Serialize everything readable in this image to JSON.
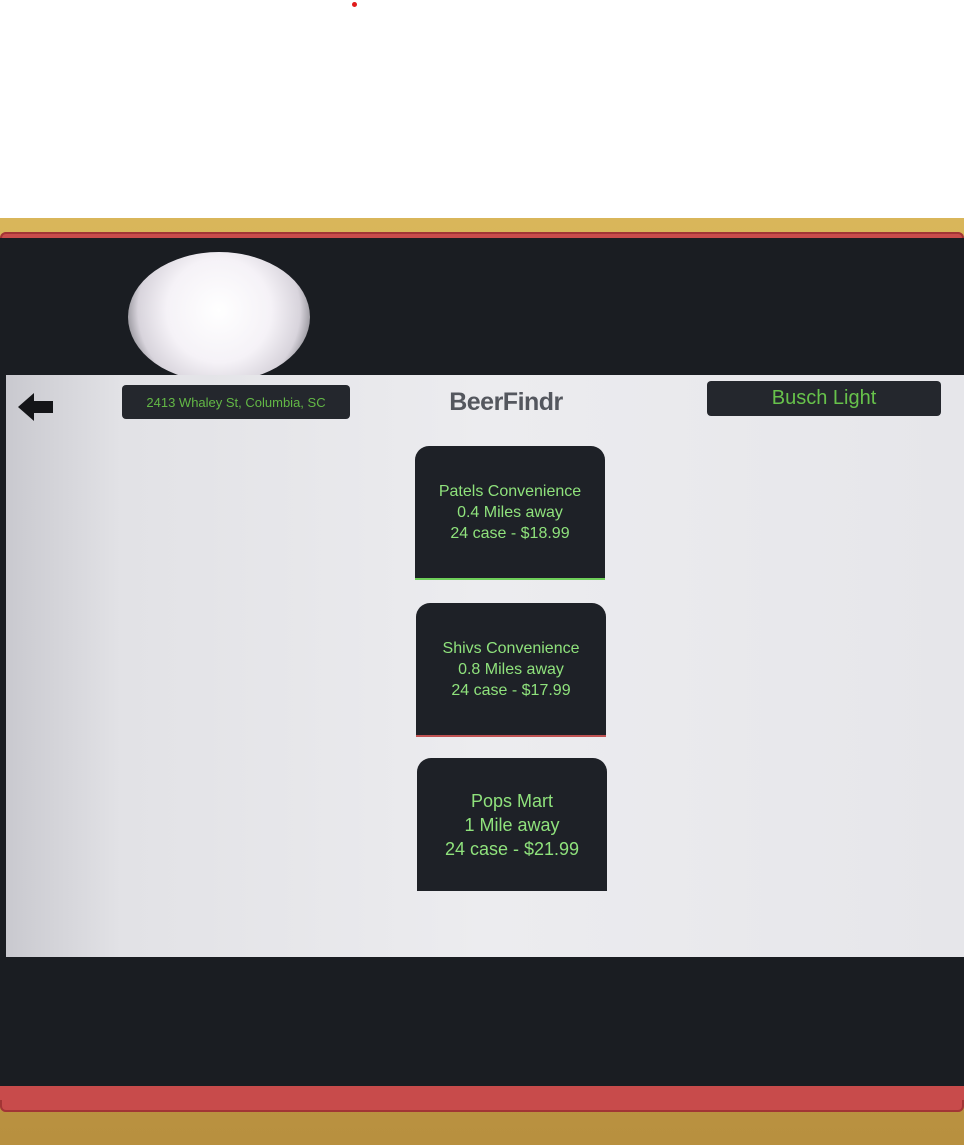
{
  "header": {
    "address": "2413 Whaley St, Columbia, SC",
    "title": "BeerFindr",
    "selected_beer": "Busch Light"
  },
  "stores": [
    {
      "name": "Patels Convenience",
      "distance": "0.4 Miles away",
      "price": "24 case - $18.99"
    },
    {
      "name": "Shivs Convenience",
      "distance": "0.8 Miles away",
      "price": "24 case - $17.99"
    },
    {
      "name": "Pops Mart",
      "distance": "1 Mile away",
      "price": "24 case - $21.99"
    }
  ],
  "icons": {
    "back": "left-arrow-icon"
  },
  "colors": {
    "accent_green": "#67c24b",
    "card_dark": "#1e2127",
    "title_gray": "#54575e"
  }
}
